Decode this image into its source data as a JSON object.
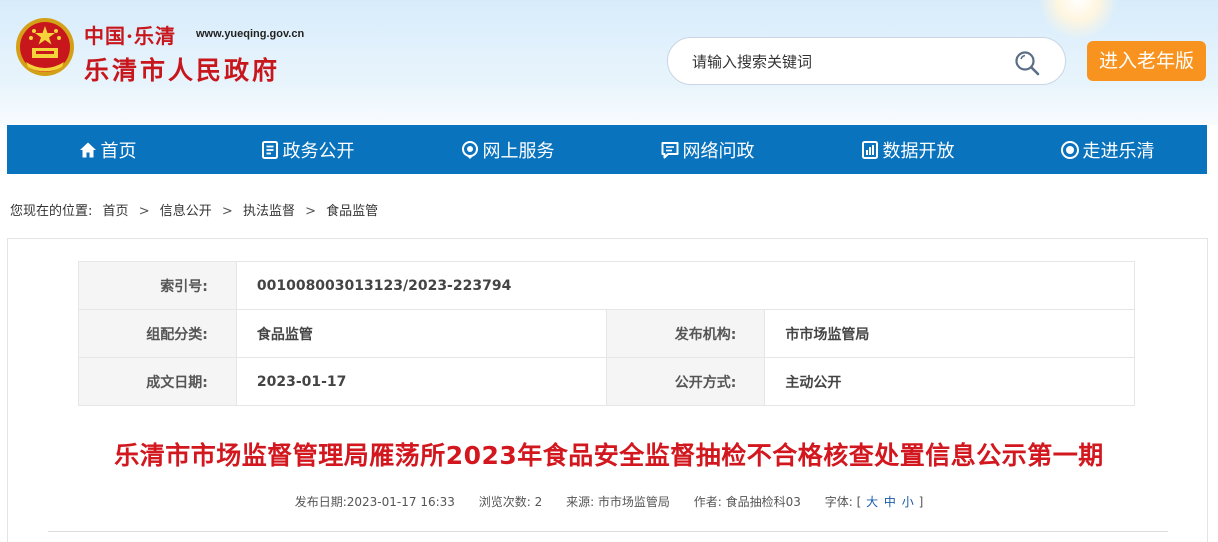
{
  "header": {
    "site_name_top": "中国·乐清",
    "site_url": "www.yueqing.gov.cn",
    "site_name_main": "乐清市人民政府",
    "search": {
      "placeholder": "请输入搜索关键词"
    },
    "elder_button": "进入老年版"
  },
  "nav": {
    "items": [
      {
        "label": "首页",
        "icon": "home-icon"
      },
      {
        "label": "政务公开",
        "icon": "document-icon"
      },
      {
        "label": "网上服务",
        "icon": "location-icon"
      },
      {
        "label": "网络问政",
        "icon": "message-icon"
      },
      {
        "label": "数据开放",
        "icon": "data-icon"
      },
      {
        "label": "走进乐清",
        "icon": "eye-icon"
      }
    ]
  },
  "breadcrumb": {
    "prefix": "您现在的位置:",
    "items": [
      "首页",
      "信息公开",
      "执法监督",
      "食品监管"
    ],
    "separator": ">"
  },
  "meta": {
    "index_label": "索引号:",
    "index_value": "001008003013123/2023-223794",
    "category_label": "组配分类:",
    "category_value": "食品监管",
    "publisher_label": "发布机构:",
    "publisher_value": "市市场监管局",
    "date_label": "成文日期:",
    "date_value": "2023-01-17",
    "open_label": "公开方式:",
    "open_value": "主动公开"
  },
  "article": {
    "title": "乐清市市场监督管理局雁荡所2023年食品安全监督抽检不合格核查处置信息公示第一期",
    "publish_date": "发布日期:2023-01-17 16:33",
    "views": "浏览次数: 2",
    "source": "来源: 市市场监管局",
    "author": "作者: 食品抽检科03",
    "font_label": "字体:",
    "font_options": [
      "大",
      "中",
      "小"
    ]
  },
  "colors": {
    "nav_bg": "#0a73bd",
    "title_red": "#d2171f",
    "elder_orange": "#f7931e"
  }
}
